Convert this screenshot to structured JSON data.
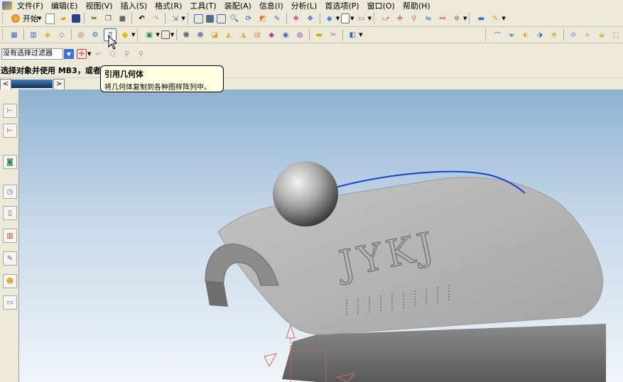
{
  "menu": {
    "items": [
      "文件(F)",
      "编辑(E)",
      "视图(V)",
      "插入(S)",
      "格式(R)",
      "工具(T)",
      "装配(A)",
      "信息(I)",
      "分析(L)",
      "首选项(P)",
      "窗口(O)",
      "帮助(H)"
    ]
  },
  "toolbar1": {
    "start_label": "开始",
    "icons": [
      "new-file-icon",
      "open-folder-icon",
      "save-icon",
      "cut-icon",
      "copy-icon",
      "paste-icon",
      "undo-icon",
      "redo-icon",
      "select-icon",
      "fit-view-icon",
      "zoom-icon",
      "zoom-window-icon",
      "rotate-icon",
      "pan-icon",
      "snap-view-icon",
      "layer-icon",
      "shaded-view-icon",
      "wireframe-icon",
      "sketch-icon",
      "curve-icon",
      "datum-icon",
      "measure-icon",
      "dimension-icon",
      "layout-icon",
      "format-icon"
    ]
  },
  "toolbar2": {
    "icons": [
      "grid-icon",
      "assembly-icon",
      "component-icon",
      "extrude-icon",
      "revolve-icon",
      "sweep-icon",
      "instance-geometry-icon",
      "sphere-icon",
      "datum-plane-icon",
      "box-icon",
      "blend-icon",
      "chamfer-icon",
      "shell-icon",
      "hole-icon",
      "boss-icon",
      "pocket-icon",
      "pad-icon",
      "slot-icon",
      "groove-icon",
      "thread-icon",
      "trim-icon",
      "pattern-icon",
      "surface-icon",
      "offset-icon",
      "thicken-icon",
      "mirror-icon",
      "draft-icon",
      "knit-icon"
    ]
  },
  "filterbar": {
    "filter_value": "没有选择过滤器",
    "icons": [
      "select-dropdown-icon",
      "undo-select-icon",
      "part-navigator-icon",
      "selection-lock-icon"
    ]
  },
  "status": {
    "prompt": "选择对象并使用 MB3，或者"
  },
  "tooltip": {
    "title": "引用几何体",
    "description": "将几何体复制到各种图样阵列中。"
  },
  "left_rail": {
    "icons": [
      "assembly-navigator-icon",
      "constraint-navigator-icon",
      "part-navigator-icon",
      "history-icon",
      "reuse-library-icon",
      "color-palette-icon",
      "analysis-icon",
      "roles-icon",
      "system-materials-icon"
    ]
  },
  "model": {
    "engraved_text": "JYKJ"
  },
  "colors": {
    "toolbar_bg": "#ece9d8",
    "viewport_top": "#8fb2d0",
    "viewport_bottom": "#f0f4f8",
    "model_gray": "#a8a8a8",
    "curve_blue": "#1a3fd0",
    "tooltip_bg": "#ffffe1"
  }
}
